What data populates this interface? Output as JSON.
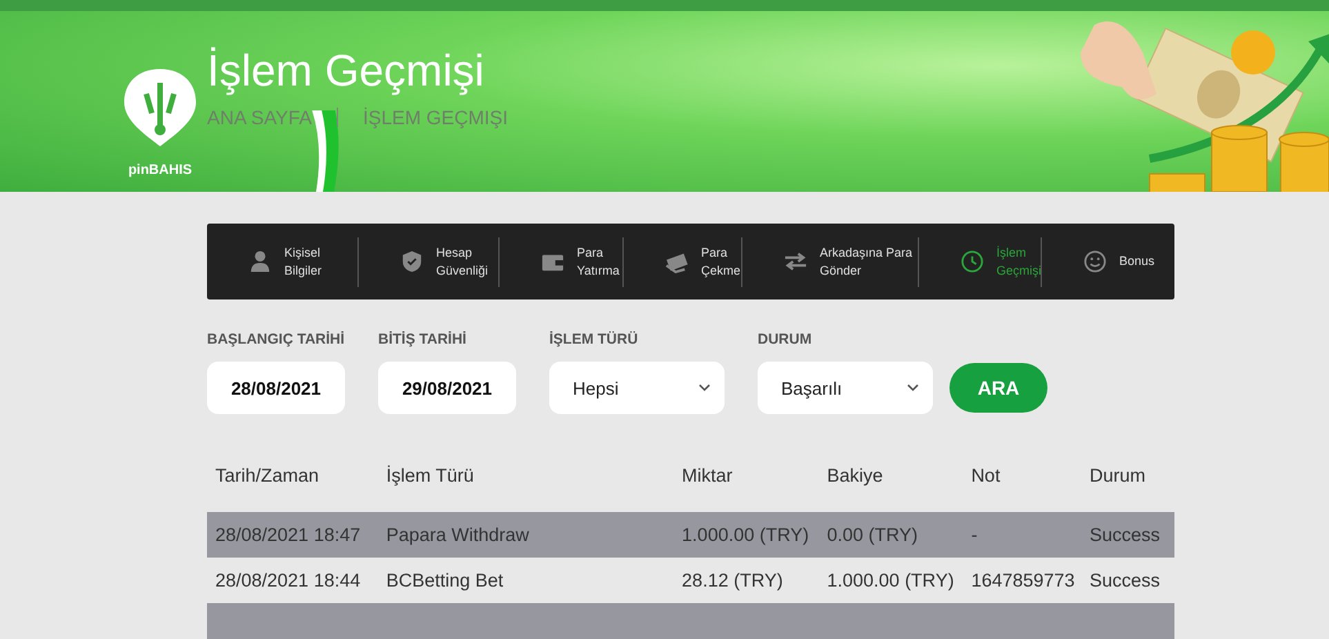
{
  "header": {
    "title": "İşlem Geçmişi",
    "breadcrumb": [
      "ANA SAYFA",
      "İŞLEM GEÇMIŞI"
    ],
    "brand": "pinBAHIS"
  },
  "account_menu": [
    {
      "kind": "person",
      "lines": [
        "Kişisel",
        "Bilgiler"
      ],
      "selected": false
    },
    {
      "kind": "shield",
      "lines": [
        "Hesap",
        "Güvenliği"
      ],
      "selected": false
    },
    {
      "kind": "wallet",
      "lines": [
        "Para",
        "Yatırma"
      ],
      "selected": false
    },
    {
      "kind": "cash",
      "lines": [
        "Para",
        "Çekme"
      ],
      "selected": false
    },
    {
      "kind": "transfer",
      "lines": [
        "Arkadaşına Para",
        "Gönder"
      ],
      "selected": false
    },
    {
      "kind": "history",
      "lines": [
        "İşlem",
        "Geçmişi"
      ],
      "selected": true
    },
    {
      "kind": "smile",
      "lines": [
        "Bonus"
      ],
      "selected": false
    }
  ],
  "filters": [
    {
      "kind": "date",
      "label": "BAŞLANGIÇ TARİHİ",
      "value": "28/08/2021"
    },
    {
      "kind": "date",
      "label": "BİTİŞ TARİHİ",
      "value": "29/08/2021"
    },
    {
      "kind": "select",
      "label": "İŞLEM TÜRÜ",
      "value": "Hepsi"
    },
    {
      "kind": "select",
      "label": "DURUM",
      "value": "Başarılı"
    }
  ],
  "search_button": "ARA",
  "table": {
    "columns": [
      "Tarih/Zaman",
      "İşlem Türü",
      "Miktar",
      "Bakiye",
      "Not",
      "Durum"
    ],
    "rows": [
      [
        "28/08/2021 18:47",
        "Papara Withdraw",
        "1.000.00 (TRY)",
        "0.00 (TRY)",
        "-",
        "Success"
      ],
      [
        "28/08/2021 18:44",
        "BCBetting Bet",
        "28.12 (TRY)",
        "1.000.00 (TRY)",
        "1647859773",
        "Success"
      ]
    ]
  }
}
